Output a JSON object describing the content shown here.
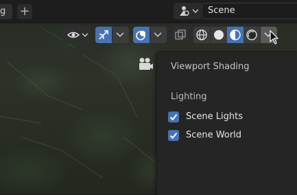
{
  "topbar": {
    "tab_fragment": "g",
    "add_tab": "+",
    "scene_name": "Scene"
  },
  "header": {
    "icons": [
      "visibility-eye-icon",
      "gizmo-icon",
      "overlay-icon",
      "xray-icon",
      "wireframe-shading-icon",
      "solid-shading-icon",
      "material-shading-icon",
      "rendered-shading-icon"
    ]
  },
  "popup": {
    "title": "Viewport Shading",
    "lighting_label": "Lighting",
    "options": [
      {
        "label": "Scene Lights",
        "checked": true
      },
      {
        "label": "Scene World",
        "checked": true
      }
    ]
  },
  "colors": {
    "checkbox": "#4772b3",
    "active_shading": "#4772b3",
    "popup_bg": "#252525"
  }
}
